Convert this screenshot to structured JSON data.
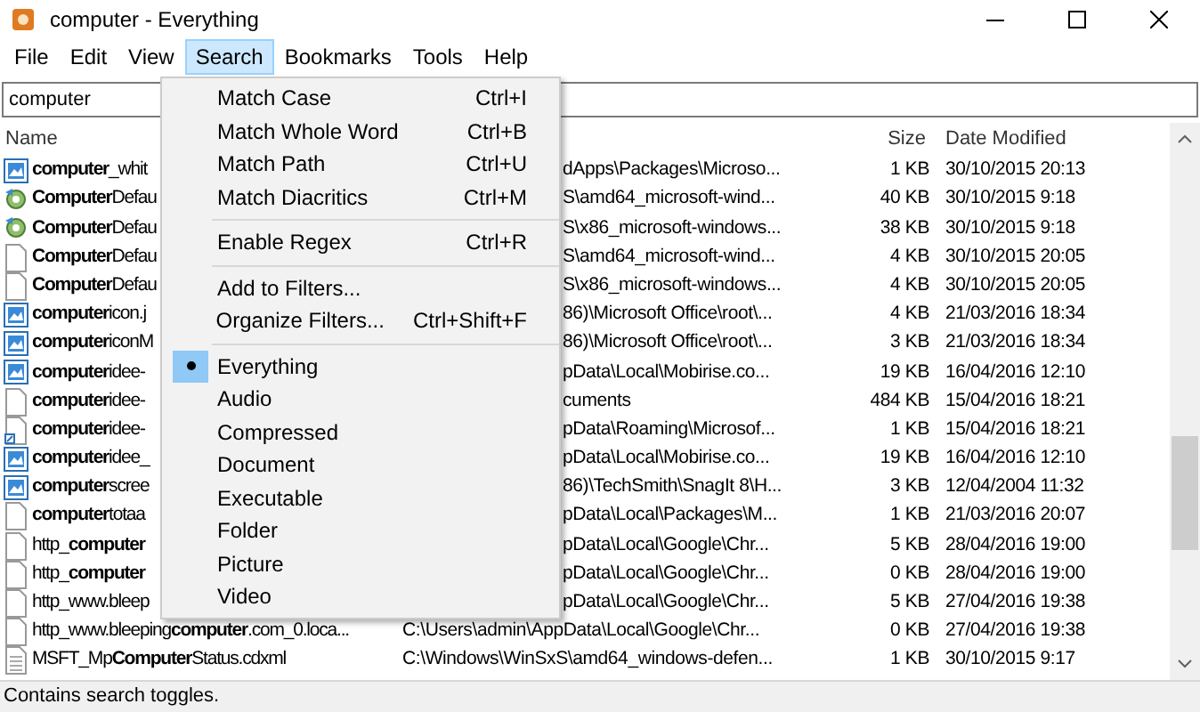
{
  "window": {
    "title": "computer - Everything"
  },
  "menu_bar": [
    {
      "label": "File",
      "open": false
    },
    {
      "label": "Edit",
      "open": false
    },
    {
      "label": "View",
      "open": false
    },
    {
      "label": "Search",
      "open": true
    },
    {
      "label": "Bookmarks",
      "open": false
    },
    {
      "label": "Tools",
      "open": false
    },
    {
      "label": "Help",
      "open": false
    }
  ],
  "search": {
    "value": "computer"
  },
  "table": {
    "columns": [
      "Name",
      "Size",
      "Date Modified"
    ],
    "rows": [
      {
        "kind": "image",
        "name": "**computer**_whit",
        "path": "dApps\\Packages\\Microso...",
        "size": "1 KB",
        "date": "30/10/2015 20:13"
      },
      {
        "kind": "config",
        "name": "**Computer**Defau",
        "path": "S\\amd64_microsoft-wind...",
        "size": "40 KB",
        "date": "30/10/2015 9:18"
      },
      {
        "kind": "config",
        "name": "**Computer**Defau",
        "path": "S\\x86_microsoft-windows...",
        "size": "38 KB",
        "date": "30/10/2015 9:18"
      },
      {
        "kind": "file",
        "name": "**Computer**Defau",
        "path": "S\\amd64_microsoft-wind...",
        "size": "4 KB",
        "date": "30/10/2015 20:05"
      },
      {
        "kind": "file",
        "name": "**Computer**Defau",
        "path": "S\\x86_microsoft-windows...",
        "size": "4 KB",
        "date": "30/10/2015 20:05"
      },
      {
        "kind": "image",
        "name": "**computer**icon.j",
        "path": "86)\\Microsoft Office\\root\\...",
        "size": "4 KB",
        "date": "21/03/2016 18:34"
      },
      {
        "kind": "image",
        "name": "**computer**iconM",
        "path": "86)\\Microsoft Office\\root\\...",
        "size": "3 KB",
        "date": "21/03/2016 18:34"
      },
      {
        "kind": "image",
        "name": "**computer**idee-",
        "path": "pData\\Local\\Mobirise.co...",
        "size": "19 KB",
        "date": "16/04/2016 12:10"
      },
      {
        "kind": "file",
        "name": "**computer**idee-",
        "path": "cuments",
        "size": "484 KB",
        "date": "15/04/2016 18:21"
      },
      {
        "kind": "link",
        "name": "**computer**idee-",
        "path": "pData\\Roaming\\Microsof...",
        "size": "1 KB",
        "date": "15/04/2016 18:21"
      },
      {
        "kind": "image",
        "name": "**computer**idee_",
        "path": "pData\\Local\\Mobirise.co...",
        "size": "19 KB",
        "date": "16/04/2016 12:10"
      },
      {
        "kind": "image",
        "name": "**computer**scree",
        "path": "86)\\TechSmith\\SnagIt 8\\H...",
        "size": "3 KB",
        "date": "12/04/2004 11:32"
      },
      {
        "kind": "file",
        "name": "**computer**totaa",
        "path": "pData\\Local\\Packages\\M...",
        "size": "1 KB",
        "date": "21/03/2016 20:07"
      },
      {
        "kind": "file",
        "name": "http_**computer**",
        "path": "pData\\Local\\Google\\Chr...",
        "size": "5 KB",
        "date": "28/04/2016 19:00"
      },
      {
        "kind": "file",
        "name": "http_**computer**",
        "path": "pData\\Local\\Google\\Chr...",
        "size": "0 KB",
        "date": "28/04/2016 19:00"
      },
      {
        "kind": "file",
        "name": "http_www.bleep",
        "path": "pData\\Local\\Google\\Chr...",
        "size": "5 KB",
        "date": "27/04/2016 19:38"
      },
      {
        "kind": "file",
        "name": "http_www.bleeping**computer**.com_0.loca...",
        "path": "C:\\Users\\admin\\AppData\\Local\\Google\\Chr...",
        "size": "0 KB",
        "date": "27/04/2016 19:38"
      },
      {
        "kind": "doc",
        "name": "MSFT_Mp**Computer**Status.cdxml",
        "path": "C:\\Windows\\WinSxS\\amd64_windows-defen...",
        "size": "1 KB",
        "date": "30/10/2015 9:17"
      }
    ]
  },
  "search_menu": [
    {
      "kind": "item",
      "label": "Match Case",
      "shortcut": "Ctrl+I"
    },
    {
      "kind": "item",
      "label": "Match Whole Word",
      "shortcut": "Ctrl+B"
    },
    {
      "kind": "item",
      "label": "Match Path",
      "shortcut": "Ctrl+U"
    },
    {
      "kind": "item",
      "label": "Match Diacritics",
      "shortcut": "Ctrl+M"
    },
    {
      "kind": "separator"
    },
    {
      "kind": "item",
      "label": "Enable Regex",
      "shortcut": "Ctrl+R"
    },
    {
      "kind": "separator"
    },
    {
      "kind": "item",
      "label": "Add to Filters..."
    },
    {
      "kind": "item",
      "label": "Organize Filters...",
      "shortcut": "Ctrl+Shift+F"
    },
    {
      "kind": "separator"
    },
    {
      "kind": "radio",
      "label": "Everything",
      "selected": true
    },
    {
      "kind": "radio",
      "label": "Audio",
      "selected": false
    },
    {
      "kind": "radio",
      "label": "Compressed",
      "selected": false
    },
    {
      "kind": "radio",
      "label": "Document",
      "selected": false
    },
    {
      "kind": "radio",
      "label": "Executable",
      "selected": false
    },
    {
      "kind": "radio",
      "label": "Folder",
      "selected": false
    },
    {
      "kind": "radio",
      "label": "Picture",
      "selected": false
    },
    {
      "kind": "radio",
      "label": "Video",
      "selected": false
    }
  ],
  "status_bar": "Contains search toggles."
}
